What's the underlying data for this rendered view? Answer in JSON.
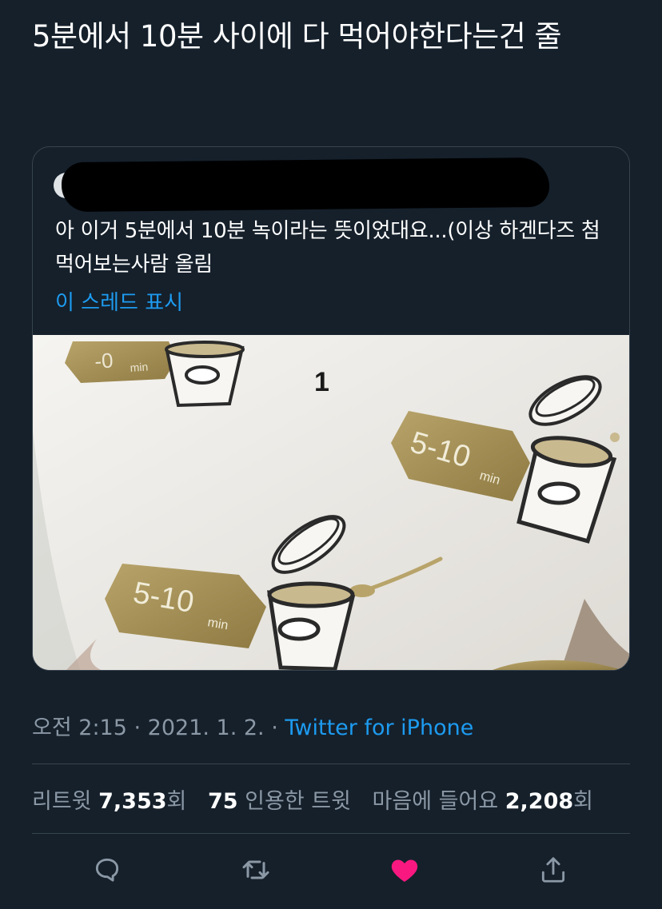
{
  "tweet": {
    "text": "5분에서 10분 사이에 다 먹어야한다는건 줄"
  },
  "quote": {
    "text": "아 이거 5분에서 10분 녹이라는 뜻이었대요...(이상 하겐다즈 첨먹어보는사람 올림",
    "show_thread": "이 스레드 표시",
    "image_labels": {
      "label_top": "5-10",
      "label_top_unit": "min",
      "label_bottom": "5-10",
      "label_bottom_unit": "min",
      "label_corner": "-0",
      "label_corner_unit": "min",
      "step_number": "1"
    }
  },
  "meta": {
    "time": "오전 2:15",
    "sep1": " · ",
    "date": "2021. 1. 2.",
    "sep2": " · ",
    "source": "Twitter for iPhone"
  },
  "stats": {
    "retweets_label": "리트윗",
    "retweets_count": "7,353",
    "retweets_suffix": "회",
    "quotes_count": "75",
    "quotes_label": "인용한 트윗",
    "likes_label": "마음에 들어요",
    "likes_count": "2,208",
    "likes_suffix": "회"
  },
  "actions": {
    "reply_icon": "reply-icon",
    "retweet_icon": "retweet-icon",
    "like_icon": "heart-icon",
    "share_icon": "share-icon"
  },
  "colors": {
    "background": "#15202b",
    "accent": "#1d9bf0",
    "muted": "#8b98a5",
    "like": "#f91880",
    "border": "#38444d"
  }
}
